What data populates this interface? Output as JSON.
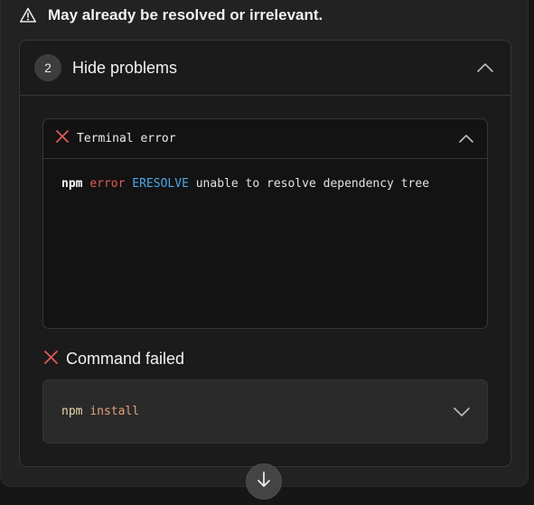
{
  "notice": {
    "icon": "warning-triangle-icon",
    "text": "May already be resolved or irrelevant."
  },
  "problems": {
    "count": "2",
    "title": "Hide problems",
    "toggle_icon": "chevron-up-icon"
  },
  "terminal_error": {
    "status_icon": "x-icon",
    "title": "Terminal error",
    "toggle_icon": "chevron-up-icon",
    "output": {
      "program": "npm",
      "level": "error",
      "code": "ERESOLVE",
      "message": "unable to resolve dependency tree"
    }
  },
  "command_failed": {
    "status_icon": "x-icon",
    "label": "Command failed",
    "command_program": "npm",
    "command_args": "install",
    "toggle_icon": "chevron-down-icon"
  },
  "scroll_button": {
    "icon": "arrow-down-icon"
  },
  "colors": {
    "error_red": "#e25c5c",
    "code_blue": "#4fa7e6",
    "command_program": "#e9d7a6",
    "command_args": "#e2a07a"
  }
}
